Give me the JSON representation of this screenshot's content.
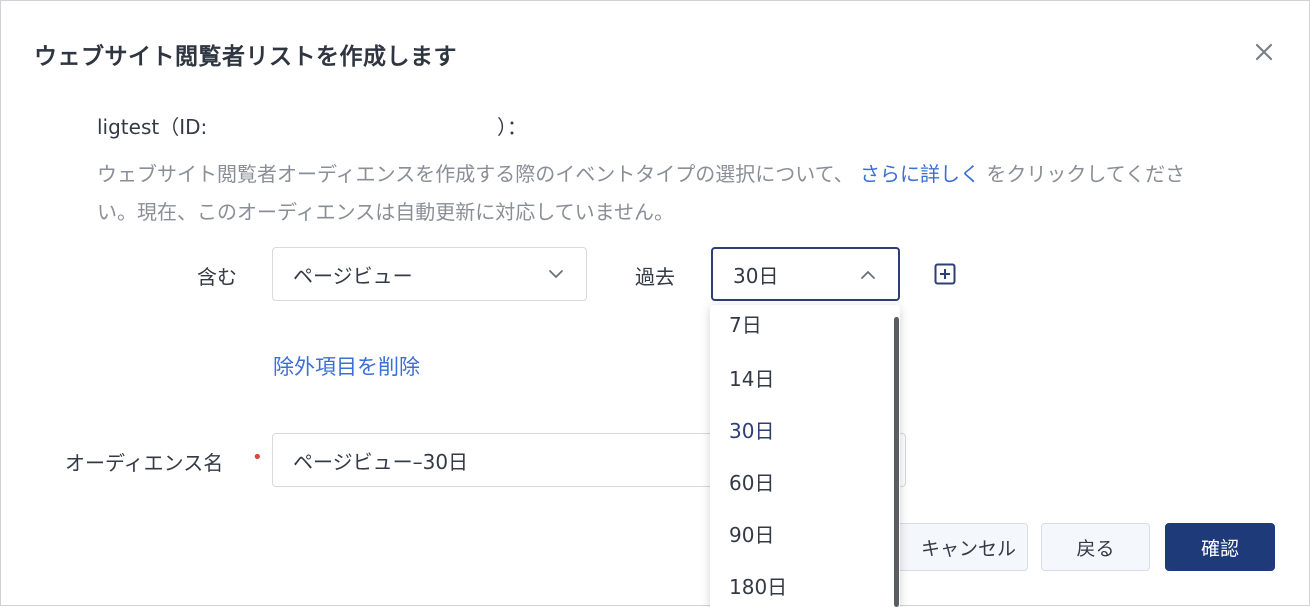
{
  "dialog": {
    "title": "ウェブサイト閲覧者リストを作成します",
    "account_name": "ligtest（ID:",
    "account_close": "）："
  },
  "description": {
    "before_link": "ウェブサイト閲覧者オーディエンスを作成する際のイベントタイプの選択について、",
    "link": "さらに詳しく",
    "after_link": "をクリックしてください。現在、このオーディエンスは自動更新に対応していません。"
  },
  "rule": {
    "include_label": "含む",
    "event_value": "ページビュー",
    "period_label": "過去",
    "period_value": "30日"
  },
  "remove_exclusion_link": "除外項目を削除",
  "audience_name": {
    "label": "オーディエンス名",
    "required_mark": "•",
    "value": "ページビュー–30日"
  },
  "period_dropdown": {
    "options": [
      "7日",
      "14日",
      "30日",
      "60日",
      "90日",
      "180日"
    ],
    "selected": "30日"
  },
  "buttons": {
    "cancel": "キャンセル",
    "back": "戻る",
    "confirm": "確認"
  },
  "colors": {
    "primary": "#1f3a78",
    "link": "#3b6fd6",
    "required": "#e0443e"
  }
}
